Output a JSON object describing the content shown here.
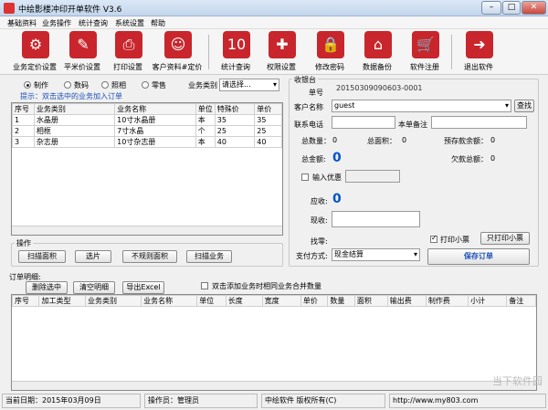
{
  "window": {
    "title": "中绘影楼冲印开单软件 V3.6",
    "min": "–",
    "max": "□",
    "close": "✕"
  },
  "menu": [
    "基础资料",
    "业务操作",
    "统计查询",
    "系统设置",
    "帮助"
  ],
  "toolbar": [
    {
      "label": "业务定价设置",
      "icon": "gear-icon",
      "glyph": "⚙"
    },
    {
      "label": "平米价设置",
      "icon": "wrench-icon",
      "glyph": "✎"
    },
    {
      "label": "打印设置",
      "icon": "printer-icon",
      "glyph": "⎙"
    },
    {
      "label": "客户资料#定价",
      "icon": "contact-card-icon",
      "glyph": "☺"
    },
    {
      "label": "统计查询",
      "icon": "calendar-icon",
      "glyph": "10"
    },
    {
      "label": "权限设置",
      "icon": "shield-icon",
      "glyph": "✚"
    },
    {
      "label": "修改密码",
      "icon": "lock-icon",
      "glyph": "🔒"
    },
    {
      "label": "数据备份",
      "icon": "home-icon",
      "glyph": "⌂"
    },
    {
      "label": "软件注册",
      "icon": "cart-icon",
      "glyph": "🛒"
    },
    {
      "label": "退出软件",
      "icon": "exit-arrow-icon",
      "glyph": "➜"
    }
  ],
  "business": {
    "types": [
      "制作",
      "数码",
      "照相",
      "零售"
    ],
    "selected_type": "制作",
    "category_label": "业务类别",
    "category_value": "请选择...",
    "hint": "提示：双击选中的业务加入订单"
  },
  "items_table": {
    "headers": [
      "序号",
      "业务类别",
      "业务名称",
      "单位",
      "特殊价",
      "单价"
    ],
    "rows": [
      [
        "1",
        "水晶册",
        "10寸水晶册",
        "本",
        "35",
        "35"
      ],
      [
        "2",
        "相框",
        "7寸水晶",
        "个",
        "25",
        "25"
      ],
      [
        "3",
        "杂志册",
        "10寸杂志册",
        "本",
        "40",
        "40"
      ]
    ]
  },
  "operations": {
    "title": "操作",
    "buttons": [
      "扫描面积",
      "选片",
      "不规则面积",
      "扫描业务"
    ]
  },
  "cashier": {
    "title": "收银台",
    "order_no_label": "单号",
    "order_no": "20150309090603-0001",
    "customer_label": "客户名称",
    "customer_value": "guest",
    "search_button": "查找",
    "phone_label": "联系电话",
    "remark_label": "本单备注",
    "total_qty_label": "总数量：",
    "total_qty": "0",
    "total_area_label": "总面积：",
    "total_area": "0",
    "deposit_label": "预存款余额：",
    "deposit": "0",
    "total_amount_label": "总金额:",
    "total_amount": "0",
    "owed_label": "欠款总额：",
    "owed": "0",
    "discount_label": "输入优惠",
    "receivable_label": "应收:",
    "receivable": "0",
    "received_label": "现收:",
    "change_label": "找零:",
    "print_ticket_label": "打印小票",
    "print_only_button": "只打印小票",
    "payment_label": "支付方式:",
    "payment_value": "现金结算",
    "save_button": "保存订单"
  },
  "order_detail": {
    "title": "订单明细:",
    "delete_button": "删除选中",
    "clear_button": "清空明细",
    "export_button": "导出Excel",
    "merge_label": "双击添加业务时相同业务合并数量",
    "headers": [
      "序号",
      "加工类型",
      "业务类别",
      "业务名称",
      "单位",
      "长度",
      "宽度",
      "单价",
      "数量",
      "面积",
      "输出费",
      "制作费",
      "小计",
      "备注"
    ]
  },
  "status": {
    "date": "当前日期：2015年03月09日",
    "operator": "操作员：管理员",
    "copyright": "中绘软件 版权所有(C)",
    "url": "http://www.my803.com"
  },
  "watermark": "当下软件园"
}
